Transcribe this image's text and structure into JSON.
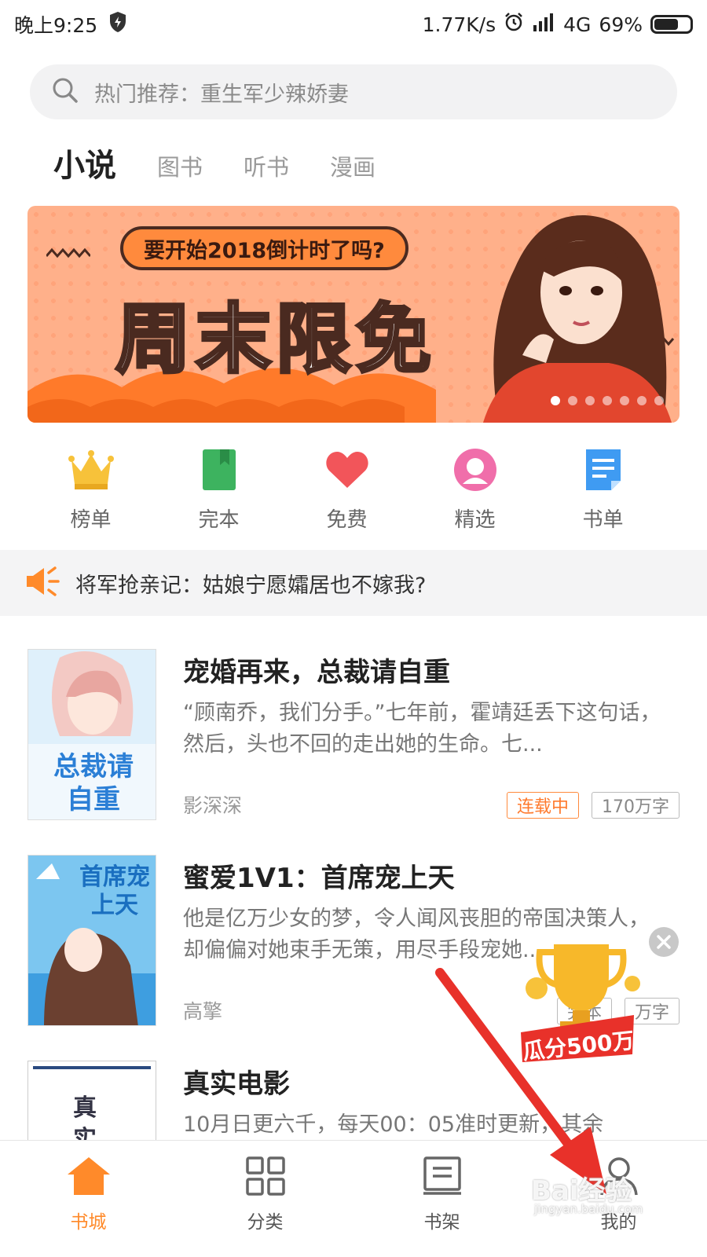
{
  "status_bar": {
    "time": "晚上9:25",
    "speed": "1.77K/s",
    "network": "4G",
    "battery": "69%",
    "battery_level": 0.69
  },
  "search": {
    "placeholder": "热门推荐：重生军少辣娇妻"
  },
  "tabs": [
    {
      "label": "小说",
      "active": true
    },
    {
      "label": "图书"
    },
    {
      "label": "听书"
    },
    {
      "label": "漫画"
    }
  ],
  "banner": {
    "pill_text": "要开始2018倒计时了吗?",
    "title": "周末限免",
    "slide_count": 7,
    "current_slide": 1
  },
  "quick_nav": [
    {
      "label": "榜单",
      "icon": "crown-icon"
    },
    {
      "label": "完本",
      "icon": "bookmark-book-icon"
    },
    {
      "label": "免费",
      "icon": "heart-icon"
    },
    {
      "label": "精选",
      "icon": "person-circle-icon"
    },
    {
      "label": "书单",
      "icon": "document-list-icon"
    }
  ],
  "notice": {
    "text": "将军抢亲记：姑娘宁愿孀居也不嫁我?",
    "icon": "megaphone-icon"
  },
  "books": [
    {
      "title": "宠婚再来，总裁请自重",
      "desc": "“顾南乔，我们分手。”七年前，霍靖廷丢下这句话，然后，头也不回的走出她的生命。七...",
      "author": "影深深",
      "status": "连载中",
      "words": "170万字",
      "cover_text": "总裁请自重"
    },
    {
      "title": "蜜爱1V1：首席宠上天",
      "desc": "他是亿万少女的梦，令人闻风丧胆的帝国决策人，却偏偏对她束手无策，用尽手段宠她...",
      "author": "高擎",
      "status": "完本",
      "words": "万字",
      "cover_text": "首席宠上天"
    },
    {
      "title": "真实电影",
      "desc": "10月日更六千，每天00：05准时更新，其余",
      "author": "",
      "cover_text": "真实"
    }
  ],
  "float_award": {
    "text": "瓜分500万"
  },
  "bottom_nav": [
    {
      "label": "书城",
      "icon": "house-icon",
      "active": true
    },
    {
      "label": "分类",
      "icon": "grid-icon"
    },
    {
      "label": "书架",
      "icon": "bookshelf-icon"
    },
    {
      "label": "我的",
      "icon": "user-icon"
    }
  ],
  "watermark": {
    "text": "Bai经验",
    "url": "jingyan.baidu.com"
  },
  "colors": {
    "accent": "#ff8a2a",
    "banner": "#ffb08a",
    "arrow": "#e8312a"
  }
}
